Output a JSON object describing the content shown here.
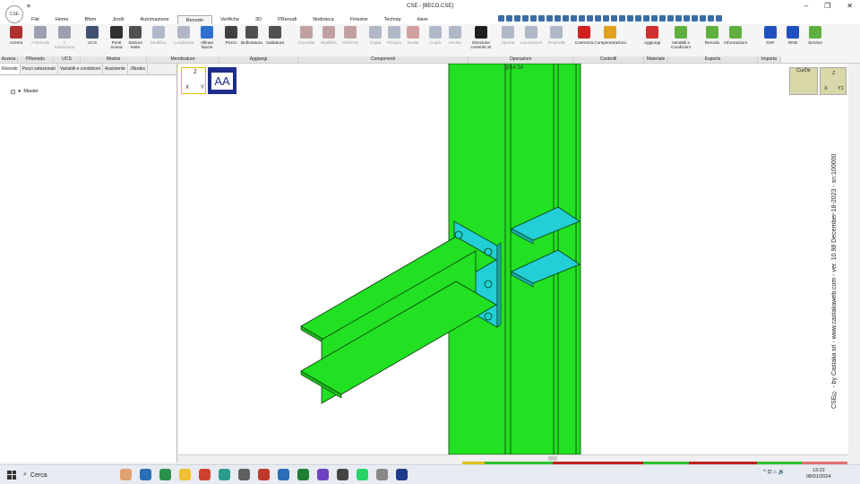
{
  "titlebar": {
    "quick_access": "¤",
    "title": "CSE - [BECO.CSE]",
    "minimize": "–",
    "maximize": "❐",
    "close": "✕"
  },
  "app_logo_text": "CSE",
  "menu": [
    "File",
    "Home",
    "Bfem",
    "Jnodi",
    "Automazione",
    "Renodo",
    "Verifiche",
    "3D",
    "PRenodi",
    "Nodoteca",
    "Finestre",
    "Technip",
    "Hare"
  ],
  "menu_active": "Renodo",
  "ribbon": {
    "buttons": [
      {
        "label": "Azzera",
        "color": "#b03030"
      },
      {
        "label": "A Renodo",
        "color": "#9aa0b0",
        "disabled": true
      },
      {
        "label": "A Subrenodo",
        "color": "#9aa0b0",
        "disabled": true
      },
      {
        "label": "UCS",
        "color": "#405070"
      },
      {
        "label": "Punti Scena",
        "color": "#303030"
      },
      {
        "label": "Sezioni nette",
        "color": "#505050"
      },
      {
        "label": "Modifica",
        "color": "#b0b8c8",
        "disabled": true
      },
      {
        "label": "Lunghezza",
        "color": "#b0b8c8",
        "disabled": true
      },
      {
        "label": "Allinea faccia",
        "color": "#2f6fd0"
      },
      {
        "label": "Pezzo",
        "color": "#404040"
      },
      {
        "label": "Bullonatura",
        "color": "#505050"
      },
      {
        "label": "Saldatura",
        "color": "#505050"
      },
      {
        "label": "Cancella",
        "color": "#c0a0a0",
        "disabled": true
      },
      {
        "label": "Modifica",
        "color": "#c0a0a0",
        "disabled": true
      },
      {
        "label": "Rinforza",
        "color": "#c0a0a0",
        "disabled": true
      },
      {
        "label": "Copia",
        "color": "#b0b8c8",
        "disabled": true
      },
      {
        "label": "Ricopia",
        "color": "#b0b8c8",
        "disabled": true
      },
      {
        "label": "Ruota",
        "color": "#d0a0a0",
        "disabled": true
      },
      {
        "label": "Copia",
        "color": "#b0b8c8",
        "disabled": true
      },
      {
        "label": "Incolla",
        "color": "#b0b8c8",
        "disabled": true
      },
      {
        "label": "Direzione corrente XI",
        "color": "#202020"
      },
      {
        "label": "Sposta",
        "color": "#b0b8c8",
        "disabled": true
      },
      {
        "label": "Lavorazioni",
        "color": "#b0b8c8",
        "disabled": true
      },
      {
        "label": "Proprietà",
        "color": "#b0b8c8",
        "disabled": true
      },
      {
        "label": "Coerenza",
        "color": "#d02020"
      },
      {
        "label": "Compenetrazioni",
        "color": "#e0a020"
      },
      {
        "label": "Aggiungi",
        "color": "#d03030"
      },
      {
        "label": "Variabili e Condizioni",
        "color": "#60b040"
      },
      {
        "label": "Renodo",
        "color": "#60b040"
      },
      {
        "label": "Informazioni",
        "color": "#60b040"
      },
      {
        "label": "DXF",
        "color": "#2050c0"
      },
      {
        "label": "RND",
        "color": "#2050c0"
      },
      {
        "label": "Service",
        "color": "#60b040"
      }
    ],
    "groups": [
      "Azzera",
      "PRenodo",
      "UCS",
      "Mostra",
      "Membrature",
      "Aggiungi",
      "Componenti",
      "Operazioni",
      "Controlli",
      "Materiale",
      "Esporta",
      "Importa"
    ]
  },
  "left_panel": {
    "tabs": [
      "Renodo",
      "Pezzi selezionati",
      "Variabili e condizioni",
      "Assistente",
      "JNodes"
    ],
    "tree_root": "Master"
  },
  "viewport": {
    "axes_labels": {
      "z": "Z",
      "x": "X",
      "y": "Y"
    },
    "aa_label": "AA",
    "curdir_label": "CurDir",
    "zbox_labels": {
      "z": "Z",
      "x": "X",
      "y": "Y1"
    },
    "timestamp": "@14:34",
    "side_text": "CSE© - by Castalia srl - www.castaliaweb.com - ver. 10.98 December-18-2023 - sn:100000",
    "colors": {
      "steel": "#22e022",
      "plate": "#22cfd6",
      "edge": "#0a3a0a"
    }
  },
  "taskbar": {
    "search": "Cerca",
    "time": "13:22",
    "date": "08/01/2024",
    "tray": "^ ⊡ ⌂ 🔊"
  }
}
